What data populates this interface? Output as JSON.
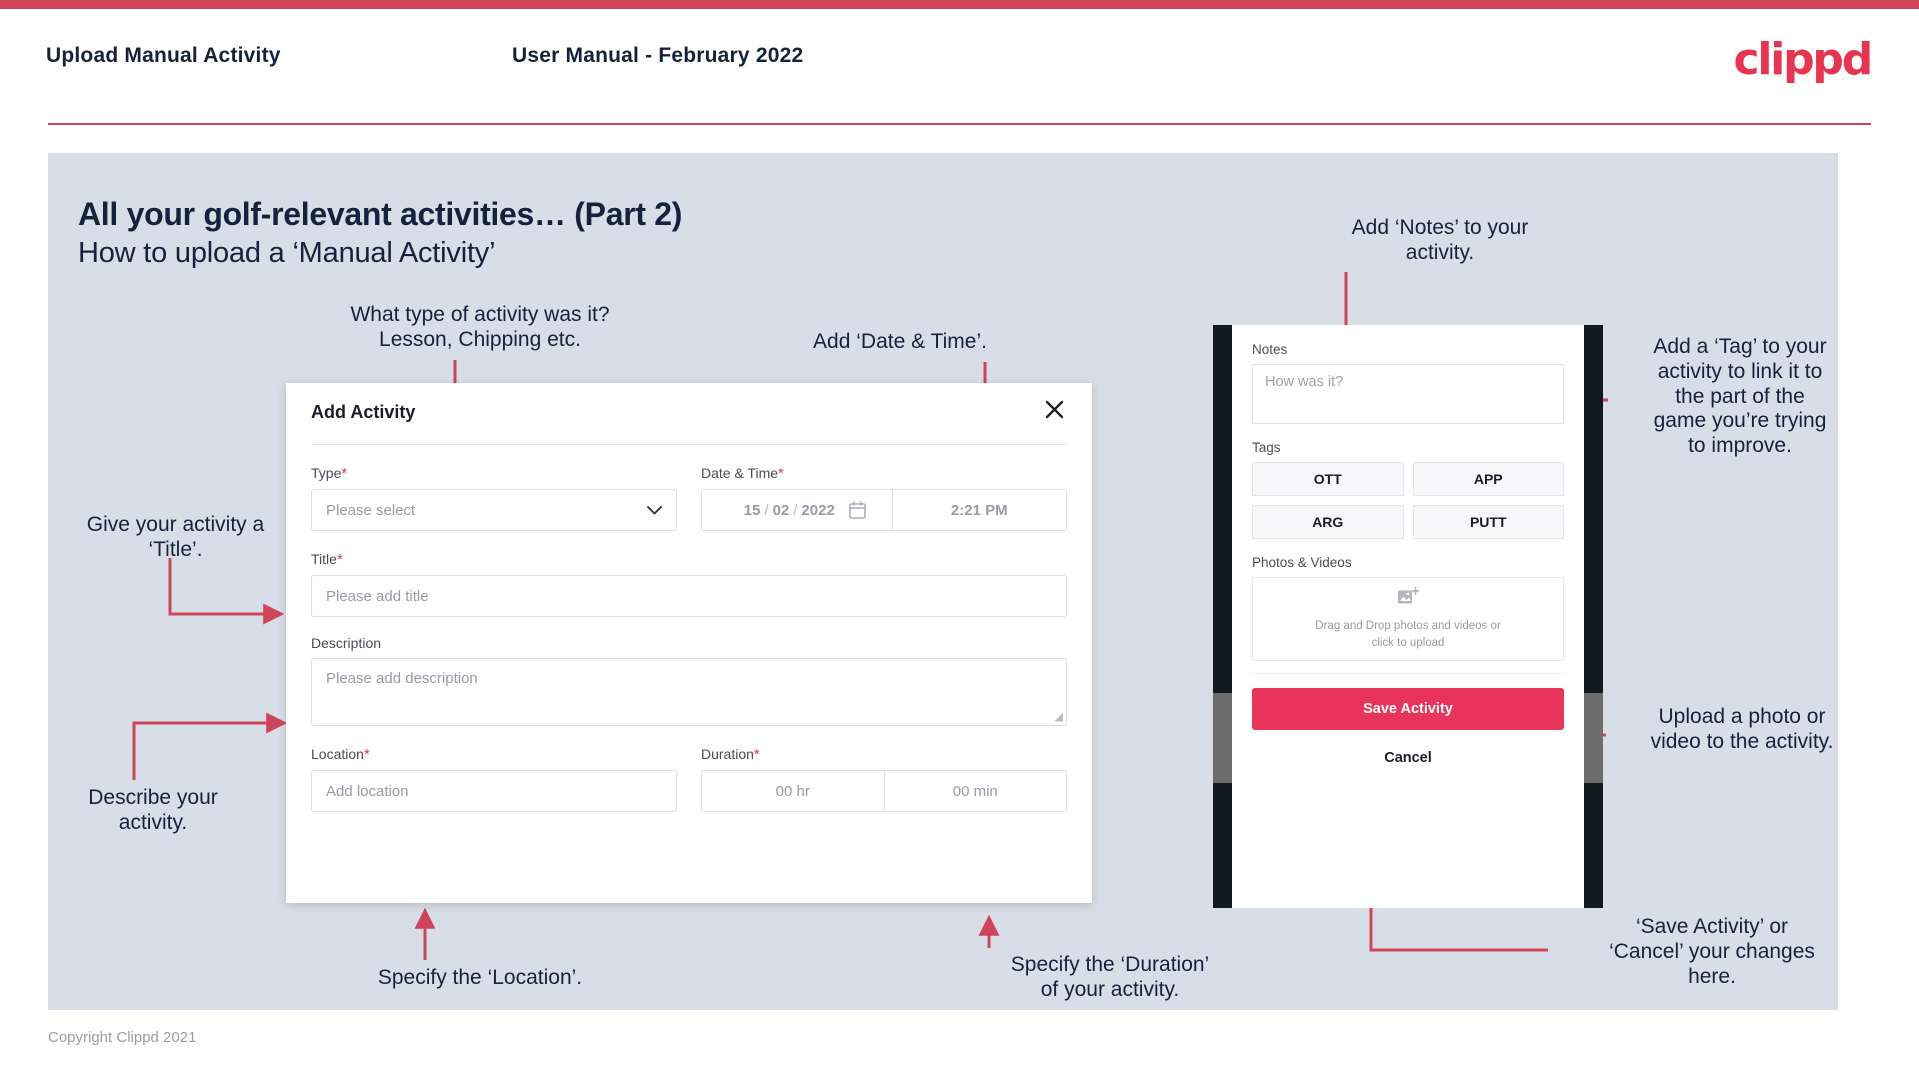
{
  "header": {
    "title": "Upload Manual Activity",
    "subtitle": "User Manual - February 2022",
    "logo": "clippd"
  },
  "slide": {
    "title": "All your golf-relevant activities… (Part 2)",
    "subtitle": "How to upload a ‘Manual Activity’"
  },
  "annotations": {
    "type": "What type of activity was it?\nLesson, Chipping etc.",
    "datetime": "Add ‘Date & Time’.",
    "title_field": "Give your activity a\n‘Title’.",
    "description": "Describe your\nactivity.",
    "location": "Specify the ‘Location’.",
    "duration": "Specify the ‘Duration’\nof your activity.",
    "notes": "Add ‘Notes’ to your\nactivity.",
    "tags": "Add a ‘Tag’ to your\nactivity to link it to\nthe part of the\ngame you’re trying\nto improve.",
    "photos": "Upload a photo or\nvideo to the activity.",
    "save_cancel": "‘Save Activity’ or\n‘Cancel’ your changes\nhere."
  },
  "dialog": {
    "title": "Add Activity",
    "close_icon": "close-icon",
    "fields": {
      "type": {
        "label": "Type",
        "required": "*",
        "placeholder": "Please select",
        "chevron_icon": "chevron-down-icon"
      },
      "datetime": {
        "label": "Date & Time",
        "required": "*",
        "day": "15",
        "month": "02",
        "year": "2022",
        "sep1": "/",
        "sep2": "/",
        "time": "2:21 PM",
        "calendar_icon": "calendar-icon"
      },
      "title": {
        "label": "Title",
        "required": "*",
        "placeholder": "Please add title"
      },
      "description": {
        "label": "Description",
        "required": "",
        "placeholder": "Please add description"
      },
      "location": {
        "label": "Location",
        "required": "*",
        "placeholder": "Add location"
      },
      "duration": {
        "label": "Duration",
        "required": "*",
        "hours_placeholder": "00 hr",
        "minutes_placeholder": "00 min"
      }
    }
  },
  "phone": {
    "notes": {
      "label": "Notes",
      "placeholder": "How was it?"
    },
    "tags": {
      "label": "Tags",
      "items": [
        "OTT",
        "APP",
        "ARG",
        "PUTT"
      ]
    },
    "photos": {
      "label": "Photos & Videos",
      "dropzone_icon": "add-image-icon",
      "dropzone_line1": "Drag and Drop photos and videos or",
      "dropzone_line2": "click to upload"
    },
    "save_label": "Save Activity",
    "cancel_label": "Cancel"
  },
  "footer": {
    "copyright": "Copyright Clippd 2021"
  },
  "colors": {
    "brand_pink": "#e8344f",
    "accent_crimson": "#cf4459",
    "slide_bg": "#d8dee7",
    "ink": "#16213c",
    "save_button": "#e8345b"
  }
}
